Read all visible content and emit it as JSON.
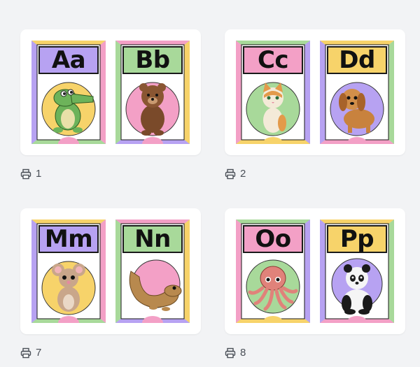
{
  "colors": {
    "purple": "#b7a2f2",
    "green": "#a8d99a",
    "pink": "#f3a0c6",
    "yellow": "#f7d36a",
    "blue": "#a8def0"
  },
  "pages": [
    {
      "page_number": "1",
      "cards": [
        {
          "letters": "Aa",
          "animal": "crocodile-illustration",
          "box_color": "#b7a2f2",
          "circle_color": "#f7d36a"
        },
        {
          "letters": "Bb",
          "animal": "bear-illustration",
          "box_color": "#a8d99a",
          "circle_color": "#f3a0c6"
        }
      ]
    },
    {
      "page_number": "2",
      "cards": [
        {
          "letters": "Cc",
          "animal": "cat-illustration",
          "box_color": "#f3a0c6",
          "circle_color": "#a8d99a"
        },
        {
          "letters": "Dd",
          "animal": "dog-illustration",
          "box_color": "#f7d36a",
          "circle_color": "#b7a2f2"
        }
      ]
    },
    {
      "page_number": "7",
      "cards": [
        {
          "letters": "Mm",
          "animal": "mouse-illustration",
          "box_color": "#b7a2f2",
          "circle_color": "#f7d36a"
        },
        {
          "letters": "Nn",
          "animal": "newt-illustration",
          "box_color": "#a8d99a",
          "circle_color": "#f3a0c6"
        }
      ]
    },
    {
      "page_number": "8",
      "cards": [
        {
          "letters": "Oo",
          "animal": "octopus-illustration",
          "box_color": "#f3a0c6",
          "circle_color": "#a8d99a"
        },
        {
          "letters": "Pp",
          "animal": "panda-illustration",
          "box_color": "#f7d36a",
          "circle_color": "#b7a2f2"
        }
      ]
    }
  ]
}
